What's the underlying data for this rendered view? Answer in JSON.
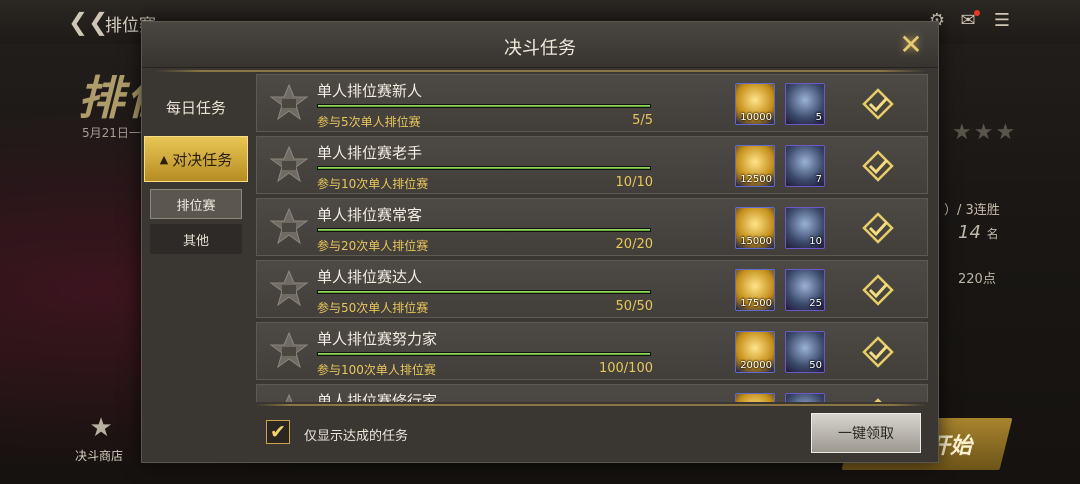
{
  "background": {
    "top_title": "排位赛",
    "logo_text": "排位",
    "date_text": "5月21日一",
    "streak_text": "）/ 3连胜",
    "rank_number": "14",
    "rank_unit": "名",
    "points_text": "220点",
    "shop_label": "决斗商店",
    "start_label": "开始"
  },
  "modal": {
    "title": "决斗任务",
    "sidebar": {
      "daily": "每日任务",
      "duel": "对决任务",
      "sub_ranked": "排位赛",
      "sub_other": "其他"
    },
    "tasks": [
      {
        "name": "单人排位赛新人",
        "desc": "参与5次单人排位赛",
        "count": "5/5",
        "progress": 1.0,
        "gold": "10000",
        "gem": "5"
      },
      {
        "name": "单人排位赛老手",
        "desc": "参与10次单人排位赛",
        "count": "10/10",
        "progress": 1.0,
        "gold": "12500",
        "gem": "7"
      },
      {
        "name": "单人排位赛常客",
        "desc": "参与20次单人排位赛",
        "count": "20/20",
        "progress": 1.0,
        "gold": "15000",
        "gem": "10"
      },
      {
        "name": "单人排位赛达人",
        "desc": "参与50次单人排位赛",
        "count": "50/50",
        "progress": 1.0,
        "gold": "17500",
        "gem": "25"
      },
      {
        "name": "单人排位赛努力家",
        "desc": "参与100次单人排位赛",
        "count": "100/100",
        "progress": 1.0,
        "gold": "20000",
        "gem": "50"
      },
      {
        "name": "单人排位赛修行家",
        "desc": "",
        "count": "",
        "progress": 1.0,
        "gold": "",
        "gem": ""
      }
    ],
    "filter_label": "仅显示达成的任务",
    "filter_checked": true,
    "claim_all_label": "一键领取"
  },
  "colors": {
    "accent_gold": "#e8c65c",
    "progress_green": "#7fc74a"
  }
}
